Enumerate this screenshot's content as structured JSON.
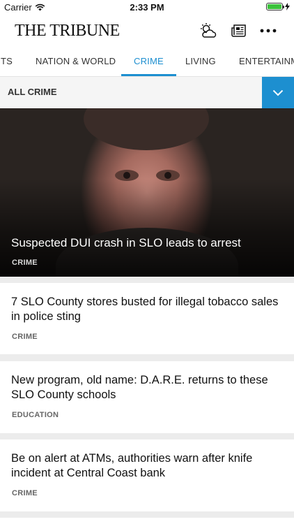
{
  "status_bar": {
    "carrier": "Carrier",
    "time": "2:33 PM"
  },
  "header": {
    "logo": "THE TRIBUNE"
  },
  "tabs": [
    {
      "label": "TS"
    },
    {
      "label": "NATION & WORLD"
    },
    {
      "label": "CRIME"
    },
    {
      "label": "LIVING"
    },
    {
      "label": "ENTERTAINME"
    }
  ],
  "section": {
    "label": "ALL CRIME"
  },
  "hero": {
    "title": "Suspected DUI crash in SLO leads to arrest",
    "category": "CRIME"
  },
  "stories": [
    {
      "title": "7 SLO County stores busted for illegal tobacco sales in police sting",
      "category": "CRIME"
    },
    {
      "title": "New program, old name: D.A.R.E. returns to these SLO County schools",
      "category": "EDUCATION"
    },
    {
      "title": "Be on alert at ATMs, authorities warn after knife incident at Central Coast bank",
      "category": "CRIME"
    }
  ],
  "colors": {
    "accent": "#1d8fd0",
    "battery": "#3cc23c"
  }
}
